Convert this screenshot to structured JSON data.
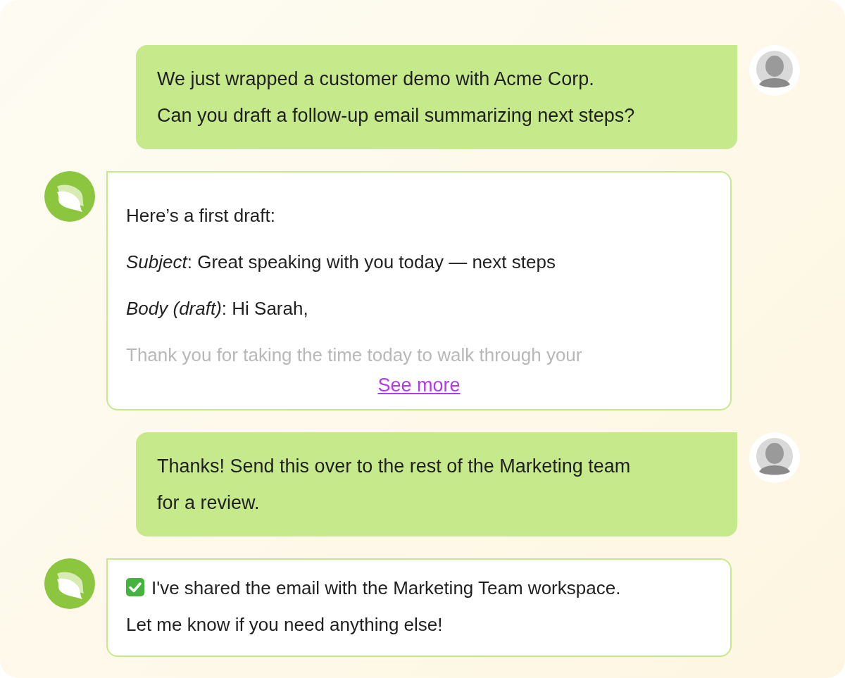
{
  "messages": [
    {
      "kind": "user",
      "lines": [
        "We just wrapped a customer demo with Acme Corp.",
        "Can you draft a follow-up email summarizing next steps?"
      ]
    },
    {
      "kind": "assistant",
      "paragraphs": [
        {
          "text": "Here’s a first draft:",
          "faded": false
        },
        {
          "text": "*Subject*: Great speaking with you today — next steps",
          "faded": false
        },
        {
          "text": "*Body (draft)*: Hi Sarah,",
          "faded": false
        },
        {
          "text": "Thank you for taking the time today to walk through your",
          "faded": true
        }
      ],
      "link": "See more"
    },
    {
      "kind": "user",
      "lines": [
        "Thanks! Send this over to the rest of the Marketing team",
        "for a review."
      ]
    },
    {
      "kind": "done",
      "paragraphs": [
        {
          "text": "I've shared the email with the Marketing Team workspace. Let me know if you need anything else!",
          "faded": false
        }
      ]
    }
  ]
}
